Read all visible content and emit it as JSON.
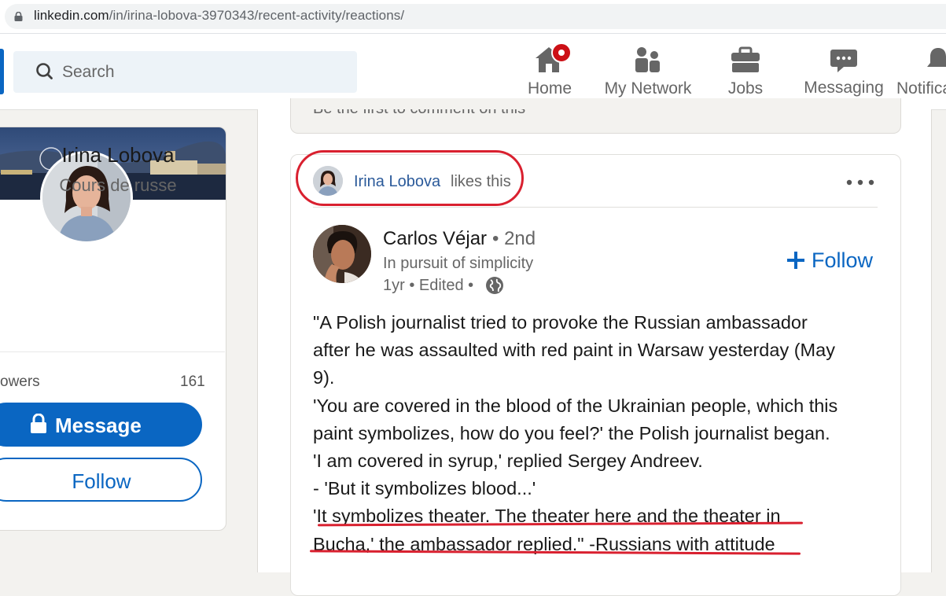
{
  "browser": {
    "url_host": "linkedin.com",
    "url_path": "/in/irina-lobova-3970343/recent-activity/reactions/"
  },
  "nav": {
    "search_placeholder": "Search",
    "items": [
      {
        "label": "Home",
        "icon": "home-icon"
      },
      {
        "label": "My Network",
        "icon": "people-icon"
      },
      {
        "label": "Jobs",
        "icon": "briefcase-icon"
      },
      {
        "label": "Messaging",
        "icon": "chat-icon"
      },
      {
        "label": "Notifica",
        "icon": "bell-icon"
      }
    ]
  },
  "profile": {
    "name": "Irina Lobova",
    "headline": "Cours de russe",
    "followers_label": "owers",
    "followers_count": "161",
    "message_label": "Message",
    "follow_label": "Follow"
  },
  "previous_card": {
    "text": "Be the first to comment on this"
  },
  "post": {
    "activity_name": "Irina Lobova",
    "activity_suffix": "likes this",
    "author_name": "Carlos Véjar",
    "author_degree": "• 2nd",
    "author_headline": "In pursuit of simplicity",
    "author_meta": "1yr • Edited •",
    "follow_label": "Follow",
    "body_lines": [
      "\"A Polish journalist tried to provoke the Russian ambassador",
      "after he was assaulted with red paint in Warsaw yesterday (May",
      "9).",
      "'You are covered in the blood of the Ukrainian people, which this",
      "paint symbolizes, how do you feel?' the Polish journalist began.",
      "'I am covered in syrup,' replied Sergey Andreev.",
      "- 'But it symbolizes blood...'",
      "'It symbolizes theater. The theater here and the theater in",
      "Bucha,' the ambassador replied.\" -Russians with attitude"
    ]
  },
  "colors": {
    "brand": "#0a66c2",
    "annotation_red": "#d9202f",
    "notification_red": "#cc1016",
    "link": "#2b5a9a"
  }
}
